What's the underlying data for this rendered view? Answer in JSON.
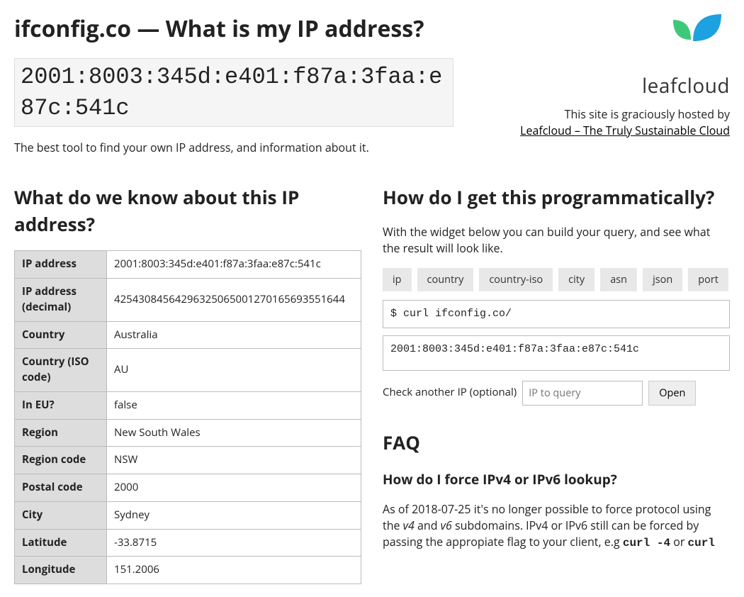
{
  "header": {
    "title": "ifconfig.co — What is my IP address?",
    "ip": "2001:8003:345d:e401:f87a:3faa:e87c:541c",
    "tagline": "The best tool to find your own IP address, and information about it."
  },
  "sponsor": {
    "logo_text": "leafcloud",
    "note": "This site is graciously hosted by",
    "link": "Leafcloud – The Truly Sustainable Cloud"
  },
  "info": {
    "heading": "What do we know about this IP address?",
    "rows": [
      {
        "k": "IP address",
        "v": "2001:8003:345d:e401:f87a:3faa:e87c:541c"
      },
      {
        "k": "IP address (decimal)",
        "v": "42543084564296325065001270165693551644"
      },
      {
        "k": "Country",
        "v": "Australia"
      },
      {
        "k": "Country (ISO code)",
        "v": "AU"
      },
      {
        "k": "In EU?",
        "v": "false"
      },
      {
        "k": "Region",
        "v": "New South Wales"
      },
      {
        "k": "Region code",
        "v": "NSW"
      },
      {
        "k": "Postal code",
        "v": "2000"
      },
      {
        "k": "City",
        "v": "Sydney"
      },
      {
        "k": "Latitude",
        "v": "-33.8715"
      },
      {
        "k": "Longitude",
        "v": "151.2006"
      }
    ]
  },
  "widget": {
    "heading": "How do I get this programmatically?",
    "desc": "With the widget below you can build your query, and see what the result will look like.",
    "buttons": [
      "ip",
      "country",
      "country-iso",
      "city",
      "asn",
      "json",
      "port"
    ],
    "cmd": "$ curl ifconfig.co/",
    "result": "2001:8003:345d:e401:f87a:3faa:e87c:541c",
    "check_label": "Check another IP (optional)",
    "placeholder": "IP to query",
    "open": "Open"
  },
  "faq": {
    "heading": "FAQ",
    "q1": "How do I force IPv4 or IPv6 lookup?",
    "a1_pre": "As of 2018-07-25 it's no longer possible to force protocol using the ",
    "a1_v4": "v4",
    "a1_mid1": " and ",
    "a1_v6": "v6",
    "a1_mid2": " subdomains. IPv4 or IPv6 still can be forced by passing the appropiate flag to your client, e.g ",
    "a1_c1": "curl -4",
    "a1_mid3": " or ",
    "a1_c2": "curl"
  }
}
